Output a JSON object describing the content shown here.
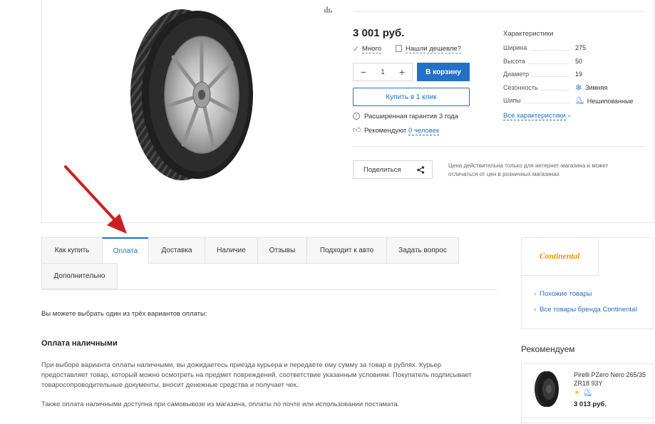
{
  "product": {
    "price": "3 001 руб.",
    "stock_label": "Много",
    "cheaper_label": "Нашли дешевле?",
    "quantity": "1",
    "qty_minus": "−",
    "qty_plus": "+",
    "cart_button": "В корзину",
    "one_click_button": "Купить в 1 клик",
    "warranty": "Расширенная гарантия 3 года",
    "recommend_prefix": "Рекомендуют ",
    "recommend_link": "0 человек",
    "share_button": "Поделиться",
    "price_note": "Цена действительна только для интернет-магазина и может отличаться от цен в розничных магазинах"
  },
  "characteristics": {
    "title": "Характеристики",
    "rows": [
      {
        "name": "Ширина",
        "value": "275",
        "icon": ""
      },
      {
        "name": "Высота",
        "value": "50",
        "icon": ""
      },
      {
        "name": "Диаметр",
        "value": "19",
        "icon": ""
      },
      {
        "name": "Сезонность",
        "value": "Зимняя",
        "icon": "snowflake-icon"
      },
      {
        "name": "Шипы",
        "value": "Нешипованные",
        "icon": "no-studs-icon"
      }
    ],
    "all_link": "Все характеристики"
  },
  "tabs": [
    {
      "label": "Как купить",
      "active": false
    },
    {
      "label": "Оплата",
      "active": true
    },
    {
      "label": "Доставка",
      "active": false
    },
    {
      "label": "Наличие",
      "active": false
    },
    {
      "label": "Отзывы",
      "active": false
    },
    {
      "label": "Подходит к авто",
      "active": false
    },
    {
      "label": "Задать вопрос",
      "active": false
    },
    {
      "label": "Дополнительно",
      "active": false
    }
  ],
  "content": {
    "intro": "Вы можете выбрать один из трёх вариантов оплаты:",
    "cash_heading": "Оплата наличными",
    "cash_text": "При выборе варианта оплаты наличными, вы дожидаетесь приезда курьера и передаёте ему сумму за товар в рублях. Курьер предоставляет товар, который можно осмотреть на предмет повреждений, соответствие указанным условиям. Покупатель подписывает товаросопроводительные документы, вносит денежные средства и получает чек.",
    "cash_text2": "Также оплата наличными доступна при самовывозе из магазина, оплаты по почте или использовании постамата."
  },
  "brand": {
    "logo_text": "Continental",
    "similar_link": "Похожие товары",
    "all_brand_link": "Все товары бренда Continental"
  },
  "recommended": {
    "title": "Рекомендуем",
    "item_name": "Pirelli PZero Nero 265/35 ZR18 93Y",
    "item_price": "3 013 руб."
  },
  "colors": {
    "accent": "#2270c8",
    "arrow": "#cc1f1f",
    "brand_orange": "#f29400"
  }
}
